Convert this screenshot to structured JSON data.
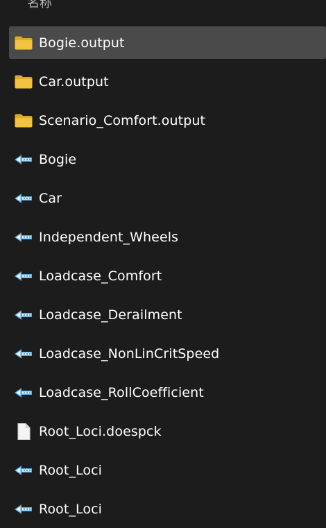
{
  "header": {
    "column_label": "名称"
  },
  "colors": {
    "background": "#1c1c1c",
    "selected_row": "#4a4a4a",
    "folder_icon": "#f3c33f",
    "model_icon": "#5aa8e0"
  },
  "files": [
    {
      "name": "Bogie.output",
      "icon": "folder-icon",
      "selected": true
    },
    {
      "name": "Car.output",
      "icon": "folder-icon"
    },
    {
      "name": "Scenario_Comfort.output",
      "icon": "folder-icon"
    },
    {
      "name": "Bogie",
      "icon": "simpack-model-icon"
    },
    {
      "name": "Car",
      "icon": "simpack-model-icon"
    },
    {
      "name": "Independent_Wheels",
      "icon": "simpack-model-icon"
    },
    {
      "name": "Loadcase_Comfort",
      "icon": "simpack-model-icon"
    },
    {
      "name": "Loadcase_Derailment",
      "icon": "simpack-model-icon"
    },
    {
      "name": "Loadcase_NonLinCritSpeed",
      "icon": "simpack-model-icon"
    },
    {
      "name": "Loadcase_RollCoefficient",
      "icon": "simpack-model-icon"
    },
    {
      "name": "Root_Loci.doespck",
      "icon": "document-icon"
    },
    {
      "name": "Root_Loci",
      "icon": "simpack-model-icon"
    },
    {
      "name": "Root_Loci",
      "icon": "simpack-model-icon"
    }
  ]
}
